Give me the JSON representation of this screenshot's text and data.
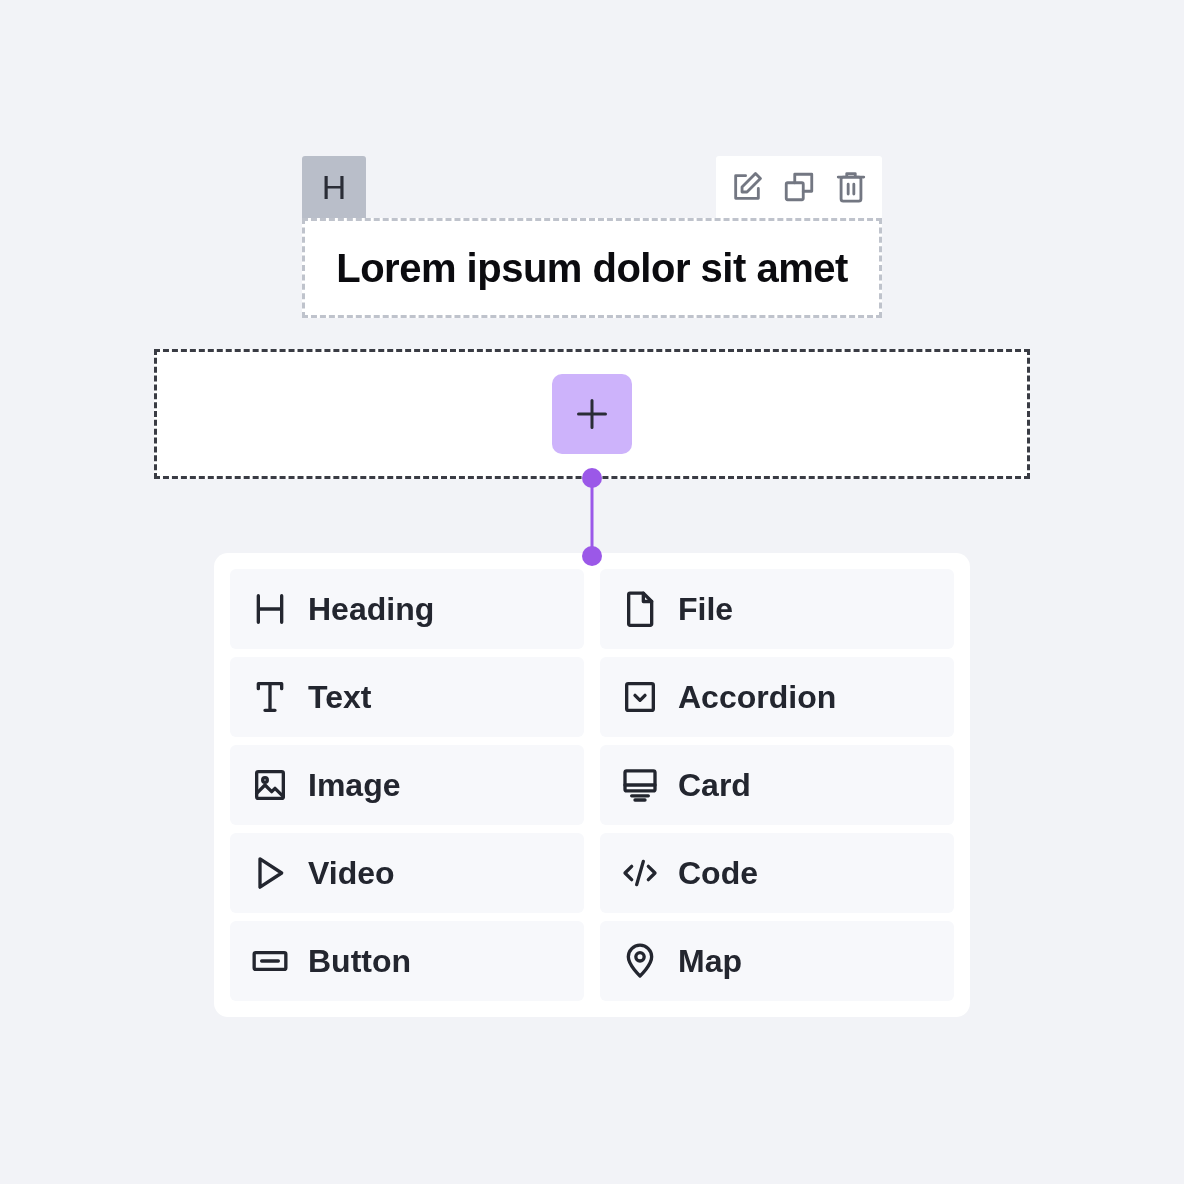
{
  "heading_block": {
    "tag": "H",
    "text": "Lorem ipsum dolor sit amet"
  },
  "element_menu": {
    "items": [
      {
        "kind": "heading",
        "label": "Heading"
      },
      {
        "kind": "file",
        "label": "File"
      },
      {
        "kind": "text",
        "label": "Text"
      },
      {
        "kind": "accordion",
        "label": "Accordion"
      },
      {
        "kind": "image",
        "label": "Image"
      },
      {
        "kind": "card",
        "label": "Card"
      },
      {
        "kind": "video",
        "label": "Video"
      },
      {
        "kind": "code",
        "label": "Code"
      },
      {
        "kind": "button",
        "label": "Button"
      },
      {
        "kind": "map",
        "label": "Map"
      }
    ]
  }
}
